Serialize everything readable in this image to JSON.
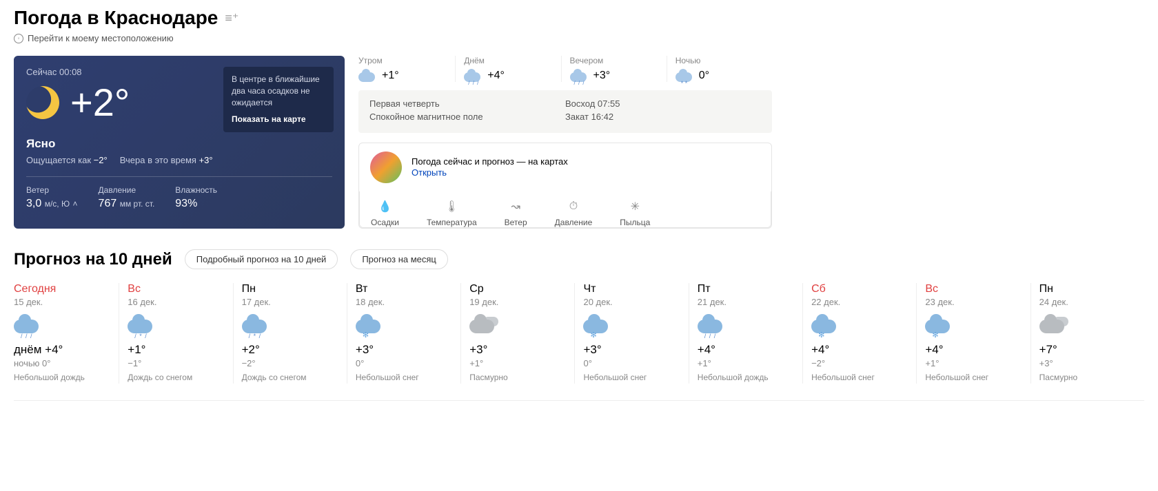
{
  "title": "Погода в Краснодаре",
  "location_link": "Перейти к моему местоположению",
  "now": {
    "time_label": "Сейчас 00:08",
    "temp": "+2°",
    "condition": "Ясно",
    "feels_label": "Ощущается как",
    "feels_val": "−2°",
    "yesterday_label": "Вчера в это время",
    "yesterday_val": "+3°",
    "tooltip_text": "В центре в ближайшие два часа осадков не ожидается",
    "tooltip_link": "Показать на карте",
    "stats": {
      "wind_label": "Ветер",
      "wind_val": "3,0",
      "wind_unit": "м/с, Ю",
      "pressure_label": "Давление",
      "pressure_val": "767",
      "pressure_unit": "мм рт. ст.",
      "humidity_label": "Влажность",
      "humidity_val": "93%"
    }
  },
  "dayparts": [
    {
      "label": "Утром",
      "temp": "+1°",
      "icon": "cloud"
    },
    {
      "label": "Днём",
      "temp": "+4°",
      "icon": "rain"
    },
    {
      "label": "Вечером",
      "temp": "+3°",
      "icon": "rain"
    },
    {
      "label": "Ночью",
      "temp": "0°",
      "icon": "snow"
    }
  ],
  "info": {
    "moon": "Первая четверть",
    "magnetic": "Спокойное магнитное поле",
    "sunrise": "Восход 07:55",
    "sunset": "Закат 16:42"
  },
  "promo": {
    "text": "Погода сейчас и прогноз — на картах",
    "link": "Открыть"
  },
  "map_tabs": [
    "Осадки",
    "Температура",
    "Ветер",
    "Давление",
    "Пыльца"
  ],
  "map_icons": [
    "💧",
    "🌡",
    "↝",
    "⏱",
    "✳"
  ],
  "forecast": {
    "title": "Прогноз на 10 дней",
    "btn_detailed": "Подробный прогноз на 10 дней",
    "btn_month": "Прогноз на месяц",
    "days": [
      {
        "name": "Сегодня",
        "date": "15 дек.",
        "weekend": true,
        "hi_label": "днём +4°",
        "lo_label": "ночью 0°",
        "cond": "Небольшой дождь",
        "icon": "rain"
      },
      {
        "name": "Вс",
        "date": "16 дек.",
        "weekend": true,
        "hi_label": "+1°",
        "lo_label": "−1°",
        "cond": "Дождь со снегом",
        "icon": "rain-snow"
      },
      {
        "name": "Пн",
        "date": "17 дек.",
        "weekend": false,
        "hi_label": "+2°",
        "lo_label": "−2°",
        "cond": "Дождь со снегом",
        "icon": "rain-snow"
      },
      {
        "name": "Вт",
        "date": "18 дек.",
        "weekend": false,
        "hi_label": "+3°",
        "lo_label": "0°",
        "cond": "Небольшой снег",
        "icon": "snow"
      },
      {
        "name": "Ср",
        "date": "19 дек.",
        "weekend": false,
        "hi_label": "+3°",
        "lo_label": "+1°",
        "cond": "Пасмурно",
        "icon": "overcast"
      },
      {
        "name": "Чт",
        "date": "20 дек.",
        "weekend": false,
        "hi_label": "+3°",
        "lo_label": "0°",
        "cond": "Небольшой снег",
        "icon": "snow"
      },
      {
        "name": "Пт",
        "date": "21 дек.",
        "weekend": false,
        "hi_label": "+4°",
        "lo_label": "+1°",
        "cond": "Небольшой дождь",
        "icon": "rain"
      },
      {
        "name": "Сб",
        "date": "22 дек.",
        "weekend": true,
        "hi_label": "+4°",
        "lo_label": "−2°",
        "cond": "Небольшой снег",
        "icon": "snow"
      },
      {
        "name": "Вс",
        "date": "23 дек.",
        "weekend": true,
        "hi_label": "+4°",
        "lo_label": "+1°",
        "cond": "Небольшой снег",
        "icon": "snow"
      },
      {
        "name": "Пн",
        "date": "24 дек.",
        "weekend": false,
        "hi_label": "+7°",
        "lo_label": "+3°",
        "cond": "Пасмурно",
        "icon": "overcast"
      }
    ]
  }
}
